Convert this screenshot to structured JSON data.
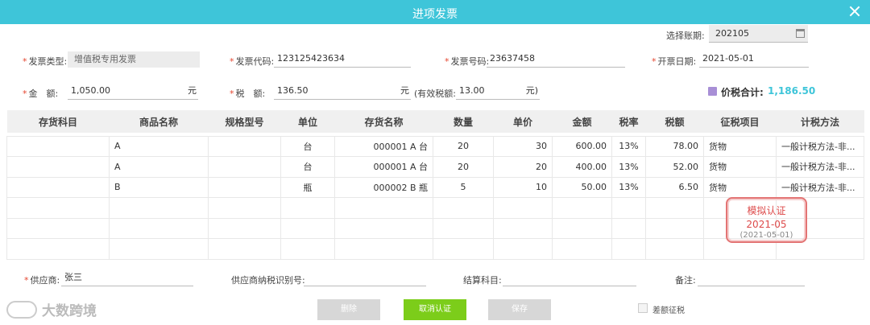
{
  "window": {
    "title": "进项发票"
  },
  "period": {
    "label": "选择账期:",
    "value": "202105"
  },
  "form": {
    "invoice_type": {
      "label": "发票类型:",
      "value": "增值税专用发票"
    },
    "invoice_code": {
      "label": "发票代码:",
      "value": "123125423634"
    },
    "invoice_number": {
      "label": "发票号码:",
      "value": "23637458"
    },
    "invoice_date": {
      "label": "开票日期:",
      "value": "2021-05-01"
    },
    "amount": {
      "label": "金　额:",
      "value": "1,050.00",
      "unit": "元"
    },
    "tax": {
      "label": "税　额:",
      "value": "136.50",
      "unit": "元"
    },
    "effective_tax": {
      "label": "(有效税额:",
      "value": "13.00",
      "unit": "元)"
    },
    "total": {
      "label": "价税合计:",
      "value": "1,186.50"
    }
  },
  "table": {
    "columns": [
      "存货科目",
      "商品名称",
      "规格型号",
      "单位",
      "存货名称",
      "数量",
      "单价",
      "金额",
      "税率",
      "税额",
      "征税项目",
      "计税方法"
    ],
    "rows": [
      [
        "",
        "A",
        "",
        "台",
        "000001 A 台",
        "20",
        "30",
        "600.00",
        "13%",
        "78.00",
        "货物",
        "一般计税方法-非..."
      ],
      [
        "",
        "A",
        "",
        "台",
        "000001 A 台",
        "20",
        "20",
        "400.00",
        "13%",
        "52.00",
        "货物",
        "一般计税方法-非..."
      ],
      [
        "",
        "B",
        "",
        "瓶",
        "000002 B 瓶",
        "5",
        "10",
        "50.00",
        "13%",
        "6.50",
        "货物",
        "一般计税方法-非..."
      ]
    ]
  },
  "stamp": {
    "line1": "模拟认证",
    "line2": "2021-05",
    "line3": "(2021-05-01)"
  },
  "footer": {
    "supplier": {
      "label": "供应商:",
      "value": "张三"
    },
    "supplier_tax_id": {
      "label": "供应商纳税识别号:",
      "value": ""
    },
    "settlement_account": {
      "label": "结算科目:",
      "value": ""
    },
    "remark": {
      "label": "备注:",
      "value": ""
    }
  },
  "buttons": {
    "delete": "删除",
    "cancel_cert": "取消认证",
    "save": "保存"
  },
  "diff_tax": {
    "label": "差额征税"
  },
  "brand": {
    "name": "大数跨境"
  },
  "colors": {
    "header": "#3ec5d9",
    "primary_button": "#7ccd1a",
    "stamp": "#dd4a4a"
  }
}
